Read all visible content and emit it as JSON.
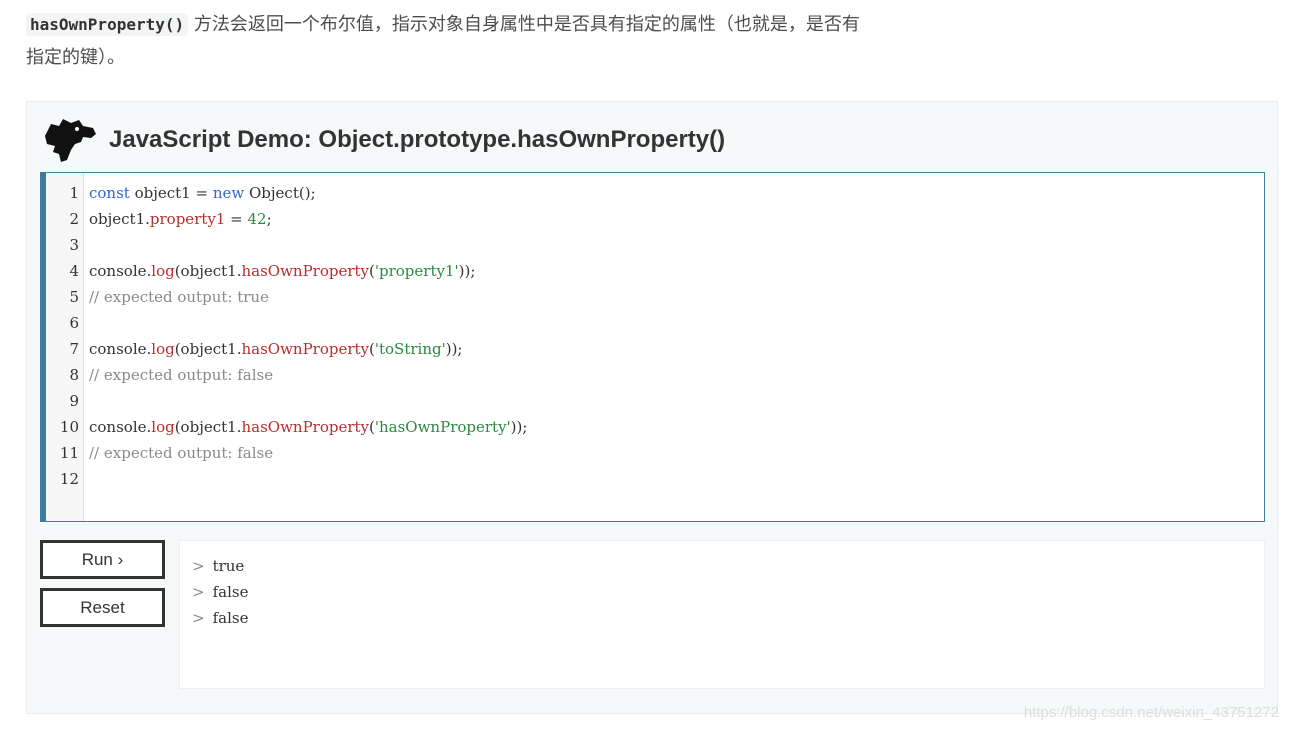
{
  "intro": {
    "code": "hasOwnProperty()",
    "text": " 方法会返回一个布尔值，指示对象自身属性中是否具有指定的属性（也就是，是否有指定的键）。"
  },
  "demo": {
    "title": "JavaScript Demo: Object.prototype.hasOwnProperty()",
    "logo_icon": "dinosaur-head-icon",
    "line_numbers": [
      "1",
      "2",
      "3",
      "4",
      "5",
      "6",
      "7",
      "8",
      "9",
      "10",
      "11",
      "12"
    ],
    "code_lines": [
      [
        {
          "t": "const",
          "c": "kw"
        },
        {
          "t": " object1 = ",
          "c": ""
        },
        {
          "t": "new",
          "c": "kw"
        },
        {
          "t": " Object();",
          "c": ""
        }
      ],
      [
        {
          "t": "object1.",
          "c": ""
        },
        {
          "t": "property1",
          "c": "prop"
        },
        {
          "t": " = ",
          "c": ""
        },
        {
          "t": "42",
          "c": "num"
        },
        {
          "t": ";",
          "c": ""
        }
      ],
      [],
      [
        {
          "t": "console.",
          "c": ""
        },
        {
          "t": "log",
          "c": "prop"
        },
        {
          "t": "(object1.",
          "c": ""
        },
        {
          "t": "hasOwnProperty",
          "c": "prop"
        },
        {
          "t": "(",
          "c": ""
        },
        {
          "t": "'property1'",
          "c": "str"
        },
        {
          "t": "));",
          "c": ""
        }
      ],
      [
        {
          "t": "// expected output: true",
          "c": "cmt"
        }
      ],
      [],
      [
        {
          "t": "console.",
          "c": ""
        },
        {
          "t": "log",
          "c": "prop"
        },
        {
          "t": "(object1.",
          "c": ""
        },
        {
          "t": "hasOwnProperty",
          "c": "prop"
        },
        {
          "t": "(",
          "c": ""
        },
        {
          "t": "'toString'",
          "c": "str"
        },
        {
          "t": "));",
          "c": ""
        }
      ],
      [
        {
          "t": "// expected output: false",
          "c": "cmt"
        }
      ],
      [],
      [
        {
          "t": "console.",
          "c": ""
        },
        {
          "t": "log",
          "c": "prop"
        },
        {
          "t": "(object1.",
          "c": ""
        },
        {
          "t": "hasOwnProperty",
          "c": "prop"
        },
        {
          "t": "(",
          "c": ""
        },
        {
          "t": "'hasOwnProperty'",
          "c": "str"
        },
        {
          "t": "));",
          "c": ""
        }
      ],
      [
        {
          "t": "// expected output: false",
          "c": "cmt"
        }
      ],
      []
    ],
    "run_label": "Run ›",
    "reset_label": "Reset",
    "output_prompt": ">",
    "output_lines": [
      "true",
      "false",
      "false"
    ]
  },
  "watermark": "https://blog.csdn.net/weixin_43751272",
  "colors": {
    "accent": "#3d7e9a",
    "keyword": "#3366cc",
    "property": "#b92e2e",
    "string": "#2b8a3e",
    "comment": "#8a8a8a"
  }
}
